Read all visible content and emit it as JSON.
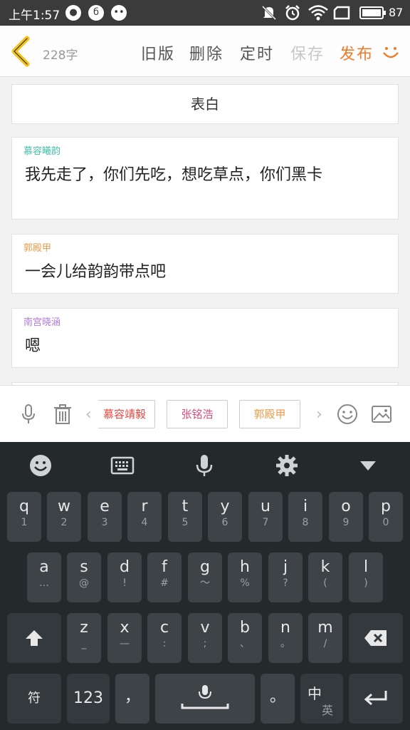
{
  "status_bar": {
    "time": "上午1:57",
    "battery": "87"
  },
  "header": {
    "word_count": "228字",
    "buttons": {
      "old_version": "旧版",
      "delete": "删除",
      "schedule": "定时",
      "save": "保存",
      "publish": "发布"
    }
  },
  "story": {
    "title": "表白",
    "messages": [
      {
        "speaker": "慕容曦韵",
        "speaker_color": "#3fbfa8",
        "text": "我先走了，你们先吃，想吃草点，你们黑卡"
      },
      {
        "speaker": "郭殿甲",
        "speaker_color": "#f09a4a",
        "text": "一会儿给韵韵带点吧"
      },
      {
        "speaker": "南宫晓涵",
        "speaker_color": "#b07ad8",
        "text": "嗯"
      }
    ]
  },
  "toolbar": {
    "characters": [
      {
        "name": "慕容靖毅",
        "color": "#e8453c"
      },
      {
        "name": "张铭浩",
        "color": "#e04a78"
      },
      {
        "name": "郭殿甲",
        "color": "#f09a4a"
      }
    ]
  },
  "keyboard": {
    "rows": [
      [
        {
          "main": "q",
          "sub": "1"
        },
        {
          "main": "w",
          "sub": "2"
        },
        {
          "main": "e",
          "sub": "3"
        },
        {
          "main": "r",
          "sub": "4"
        },
        {
          "main": "t",
          "sub": "5"
        },
        {
          "main": "y",
          "sub": "6"
        },
        {
          "main": "u",
          "sub": "7"
        },
        {
          "main": "i",
          "sub": "8"
        },
        {
          "main": "o",
          "sub": "9"
        },
        {
          "main": "p",
          "sub": "0"
        }
      ],
      [
        {
          "main": "a",
          "sub": "…"
        },
        {
          "main": "s",
          "sub": "@"
        },
        {
          "main": "d",
          "sub": "!"
        },
        {
          "main": "f",
          "sub": "#"
        },
        {
          "main": "g",
          "sub": "～"
        },
        {
          "main": "h",
          "sub": "%"
        },
        {
          "main": "j",
          "sub": "?"
        },
        {
          "main": "k",
          "sub": "("
        },
        {
          "main": "l",
          "sub": ")"
        }
      ],
      [
        {
          "main": "z",
          "sub": "_"
        },
        {
          "main": "x",
          "sub": "—"
        },
        {
          "main": "c",
          "sub": ":"
        },
        {
          "main": "v",
          "sub": ";"
        },
        {
          "main": "b",
          "sub": "、"
        },
        {
          "main": "n",
          "sub": "。"
        },
        {
          "main": "m",
          "sub": "/"
        }
      ]
    ],
    "symbols_key": "符",
    "numbers_key": "123",
    "comma_key": "，",
    "period_key": "。",
    "lang_key_main": "中",
    "lang_key_sub": "英"
  }
}
